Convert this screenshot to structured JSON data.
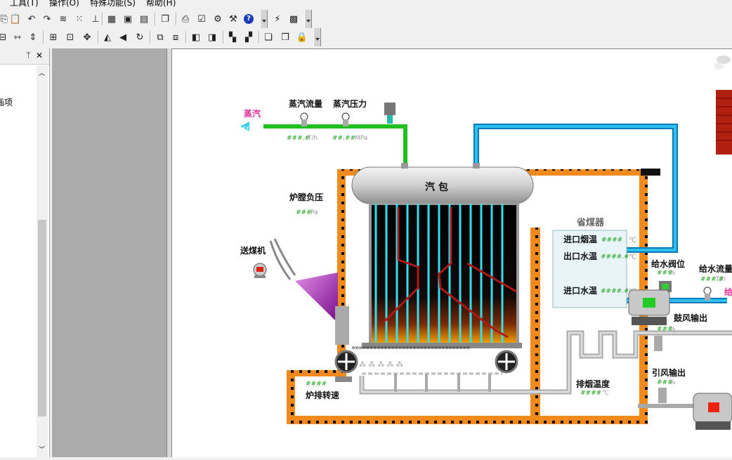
{
  "menu": {
    "tools": "工具(T)",
    "ops": "操作(O)",
    "special": "特殊功能(S)",
    "help": "帮助(H)"
  },
  "left_panel": {
    "pin": "ᛘ",
    "close": "✕",
    "item": "画项"
  },
  "diagram": {
    "steam": "蒸汽",
    "steam_flow": "蒸汽流量",
    "steam_pressure": "蒸汽压力",
    "steam_flow_val": "###.#",
    "steam_flow_unit": "T/h",
    "steam_pressure_val": "##.##",
    "steam_pressure_unit": "MPa",
    "drum": "汽  包",
    "furnace_pressure": "炉膛负压",
    "furnace_pressure_val": "###",
    "furnace_pressure_unit": "Pa",
    "coal_feeder": "送煤机",
    "grate_speed": "炉排转速",
    "grate_speed_val": "####",
    "economizer": "省煤器",
    "inlet_gas_temp": "进口烟温",
    "inlet_gas_temp_val": "####",
    "outlet_water_temp": "出口水温",
    "outlet_water_temp_val": "####.#",
    "inlet_water_temp": "进口水温",
    "inlet_water_temp_val": "####.#",
    "celsius": "℃",
    "feed_valve": "给水阀位",
    "feed_valve_val": "###",
    "percent": "%",
    "feed_flow": "给水流量",
    "feed_flow_val": "###.#",
    "feed_flow_unit": "T/h",
    "feed_partial": "给",
    "blower_output": "鼓风输出",
    "blower_output_val": "###",
    "induced_output": "引风输出",
    "induced_output_val": "###",
    "exhaust_temp": "排烟温度",
    "exhaust_temp_val": "####"
  },
  "colors": {
    "steam_pipe": "#21c021",
    "water_pipe": "#1aa0e0",
    "brick": "#f08a1c",
    "tube": "#2ee0f0",
    "drum": "#d0d0d0"
  }
}
